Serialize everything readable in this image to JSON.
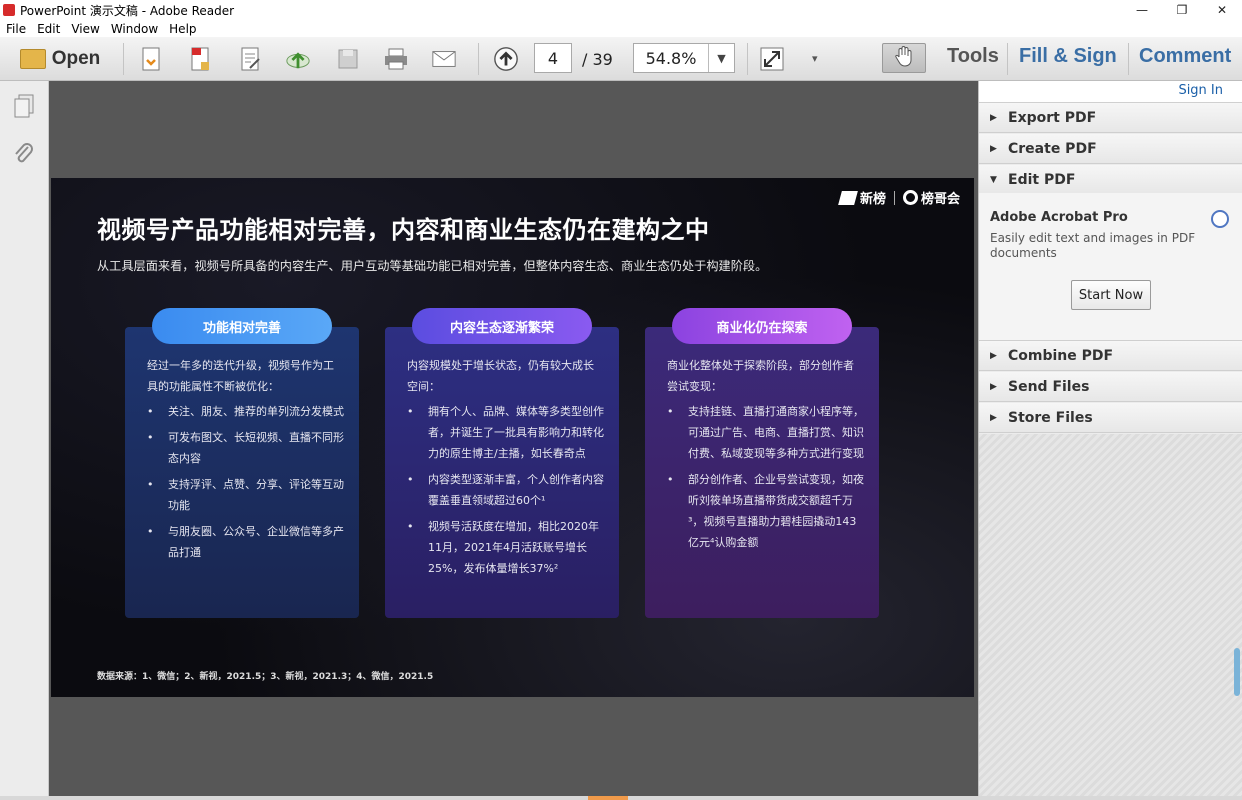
{
  "window": {
    "title": "PowerPoint 演示文稿 - Adobe Reader",
    "controls": [
      "—",
      "❐",
      "✕"
    ]
  },
  "menu": [
    "File",
    "Edit",
    "View",
    "Window",
    "Help"
  ],
  "toolbar": {
    "open_label": "Open",
    "page_current": "4",
    "page_total": "/ 39",
    "zoom": "54.8%",
    "tools_label": "Tools",
    "fill_sign_label": "Fill & Sign",
    "comment_label": "Comment"
  },
  "colors": {
    "accent_link": "#3a6ea5",
    "card1_pill": "#4a9af3",
    "card2_pill": "#7452e8",
    "card3_pill": "#a552e8"
  },
  "slide": {
    "brand1": "新榜",
    "brand2": "榜哥会",
    "title": "视频号产品功能相对完善，内容和商业生态仍在建构之中",
    "subtitle": "从工具层面来看，视频号所具备的内容生产、用户互动等基础功能已相对完善，但整体内容生态、商业生态仍处于构建阶段。",
    "cards": [
      {
        "heading": "功能相对完善",
        "intro": "经过一年多的迭代升级，视频号作为工具的功能属性不断被优化：",
        "items": [
          "关注、朋友、推荐的单列流分发模式",
          "可发布图文、长短视频、直播不同形态内容",
          "支持浮评、点赞、分享、评论等互动功能",
          "与朋友圈、公众号、企业微信等多产品打通"
        ]
      },
      {
        "heading": "内容生态逐渐繁荣",
        "intro": "内容规模处于增长状态，仍有较大成长空间：",
        "items": [
          "拥有个人、品牌、媒体等多类型创作者，并诞生了一批具有影响力和转化力的原生博主/主播，如长春奇点",
          "内容类型逐渐丰富，个人创作者内容覆盖垂直领域超过60个¹",
          "视频号活跃度在增加，相比2020年11月，2021年4月活跃账号增长25%，发布体量增长37%²"
        ]
      },
      {
        "heading": "商业化仍在探索",
        "intro": "商业化整体处于探索阶段，部分创作者尝试变现：",
        "items": [
          "支持挂链、直播打通商家小程序等，可通过广告、电商、直播打赏、知识付费、私域变现等多种方式进行变现",
          "部分创作者、企业号尝试变现，如夜听刘筱单场直播带货成交额超千万³，视频号直播助力碧桂园撬动143亿元⁴认购金额"
        ]
      }
    ],
    "footnote": "数据来源：1、微信；2、新视，2021.5；3、新视，2021.3；4、微信，2021.5"
  },
  "right_panel": {
    "signin": "Sign In",
    "sections": {
      "export": "Export PDF",
      "create": "Create PDF",
      "edit": "Edit PDF",
      "combine": "Combine PDF",
      "send": "Send Files",
      "store": "Store Files"
    },
    "edit_body": {
      "product": "Adobe Acrobat Pro",
      "description": "Easily edit text and images in PDF documents",
      "button": "Start Now"
    }
  }
}
